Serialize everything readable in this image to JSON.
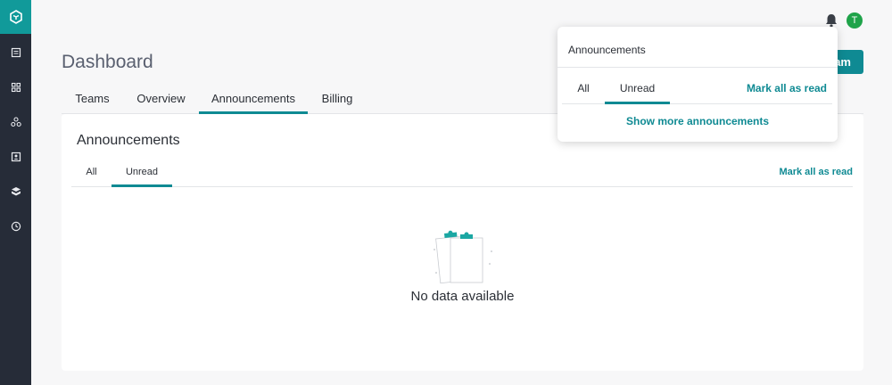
{
  "header": {
    "page_title": "Dashboard",
    "create_button_label": "am",
    "avatar_initial": "T"
  },
  "main_tabs": [
    {
      "label": "Teams",
      "active": false
    },
    {
      "label": "Overview",
      "active": false
    },
    {
      "label": "Announcements",
      "active": true
    },
    {
      "label": "Billing",
      "active": false
    }
  ],
  "card": {
    "title": "Announcements",
    "tabs": [
      {
        "label": "All",
        "active": false
      },
      {
        "label": "Unread",
        "active": true
      }
    ],
    "mark_all_label": "Mark all as read",
    "empty_text": "No data available"
  },
  "popover": {
    "title": "Announcements",
    "tabs": [
      {
        "label": "All",
        "active": false
      },
      {
        "label": "Unread",
        "active": true
      }
    ],
    "mark_all_label": "Mark all as read",
    "show_more_label": "Show more announcements"
  },
  "sidebar": {
    "icons": [
      "logo-icon",
      "book-icon",
      "grid-icon",
      "cluster-icon",
      "contact-icon",
      "cube-icon",
      "clock-icon"
    ]
  },
  "colors": {
    "accent": "#0f8a93",
    "sidebar_bg": "#262c38",
    "logo_bg": "#119a9a",
    "avatar_bg": "#1fa34a"
  }
}
